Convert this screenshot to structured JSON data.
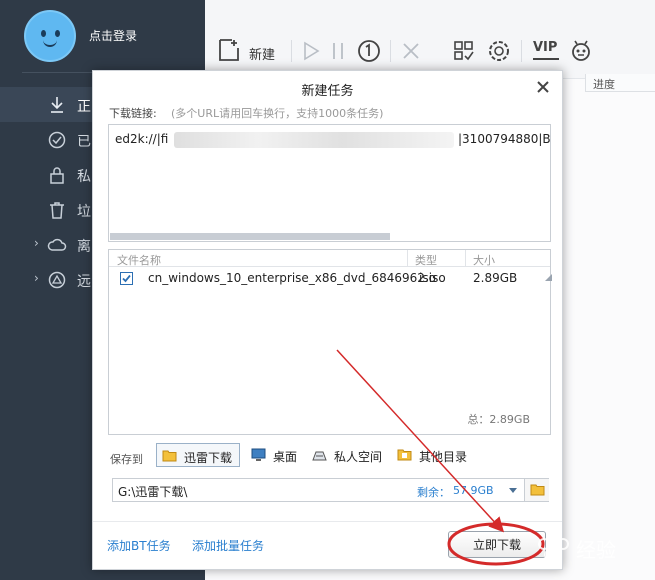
{
  "sidebar": {
    "login_label": "点击登录",
    "items": [
      {
        "label": "正",
        "icon": "download-icon",
        "active": true
      },
      {
        "label": "已",
        "icon": "check-circle-icon",
        "active": false
      },
      {
        "label": "私",
        "icon": "lock-icon",
        "active": false
      },
      {
        "label": "垃",
        "icon": "trash-icon",
        "active": false
      },
      {
        "label": "离",
        "icon": "cloud-icon",
        "active": false,
        "expandable": true
      },
      {
        "label": "远",
        "icon": "remote-icon",
        "active": false,
        "expandable": true
      }
    ]
  },
  "toolbar": {
    "new_label": "新建",
    "icons": [
      "play-icon",
      "pause-icon",
      "one-icon",
      "delete-icon",
      "grid-icon",
      "settings-icon",
      "vip-icon",
      "robot-icon"
    ],
    "vip_label": "VIP"
  },
  "list": {
    "progress_header": "进度"
  },
  "dialog": {
    "title": "新建任务",
    "link_label": "下载链接:",
    "link_hint": "(多个URL请用回车换行，支持1000条任务)",
    "url_prefix": "ed2k://|fi",
    "url_suffix": "|3100794880|B",
    "file_table": {
      "headers": [
        "文件名称",
        "类型",
        "大小"
      ],
      "rows": [
        {
          "checked": true,
          "name": "cn_windows_10_enterprise_x86_dvd_6846962.iso",
          "type": "iso",
          "size": "2.89GB"
        }
      ],
      "total": "总：2.89GB"
    },
    "save_to_label": "保存到",
    "save_options": [
      {
        "label": "迅雷下载",
        "icon": "folder-icon",
        "selected": true
      },
      {
        "label": "桌面",
        "icon": "desktop-icon",
        "selected": false
      },
      {
        "label": "私人空间",
        "icon": "private-space-icon",
        "selected": false
      },
      {
        "label": "其他目录",
        "icon": "folder-icon",
        "selected": false
      }
    ],
    "path": "G:\\迅雷下载\\",
    "free_label": "剩余：",
    "free_value": "57.9GB",
    "add_bt_label": "添加BT任务",
    "add_batch_label": "添加批量任务",
    "download_now_label": "立即下载"
  },
  "colors": {
    "sidebar_bg": "#2f3a47",
    "accent_blue": "#2a7fcf",
    "annotation_red": "#d42a2a"
  },
  "watermark": "经验"
}
